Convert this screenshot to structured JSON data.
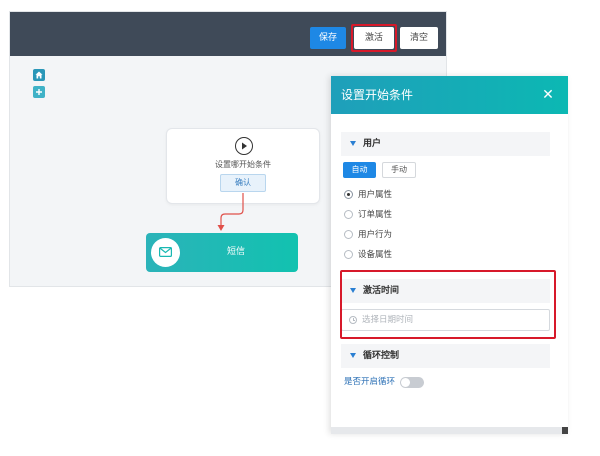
{
  "toolbar": {
    "save_label": "保存",
    "activate_label": "激活",
    "clear_label": "清空"
  },
  "sidebar": {
    "items": [
      {
        "icon": "home-icon"
      },
      {
        "icon": "plus-icon"
      }
    ]
  },
  "canvas": {
    "start_node": {
      "icon": "play-icon",
      "label": "设置哪开始条件",
      "confirm_label": "确认"
    },
    "sms_node": {
      "icon": "envelope-icon",
      "label": "短信"
    }
  },
  "panel": {
    "title": "设置开始条件",
    "close_icon": "close-icon",
    "user_section": {
      "title": "用户",
      "modes": [
        "自动",
        "手动"
      ],
      "selected_mode": "自动",
      "options": [
        "用户属性",
        "订单属性",
        "用户行为",
        "设备属性"
      ],
      "selected_option": "用户属性"
    },
    "activate_section": {
      "title": "激活时间",
      "date_placeholder": "选择日期时间"
    },
    "loop_section": {
      "title": "循环控制",
      "loop_label": "是否开启循环",
      "loop_enabled": false
    }
  },
  "colors": {
    "toolbar_bg": "#3f4a58",
    "primary": "#1e88e5",
    "teal": "#12c2b0",
    "highlight": "#d7192a",
    "connector": "#e0504a"
  }
}
